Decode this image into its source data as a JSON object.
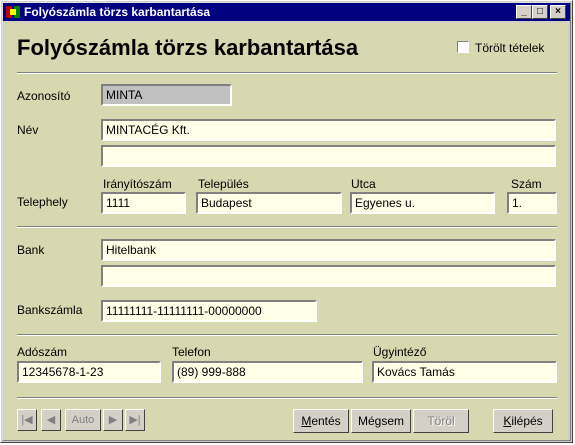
{
  "window": {
    "title": "Folyószámla törzs karbantartása",
    "minimize": "_",
    "maximize": "□",
    "close": "×"
  },
  "form": {
    "heading": "Folyószámla törzs karbantartása",
    "deleted_items_label": "Törölt tételek",
    "id_label": "Azonosító",
    "id_value": "MINTA",
    "name_label": "Név",
    "name_line1": "MINTACÉG Kft.",
    "name_line2": "",
    "site_label": "Telephely",
    "zip_label": "Irányítószám",
    "zip_value": "1111",
    "city_label": "Település",
    "city_value": "Budapest",
    "street_label": "Utca",
    "street_value": "Egyenes u.",
    "number_label": "Szám",
    "number_value": "1.",
    "bank_label": "Bank",
    "bank_line1": "Hitelbank",
    "bank_line2": "",
    "account_label": "Bankszámla",
    "account_value": "11111111-11111111-00000000",
    "tax_label": "Adószám",
    "tax_value": "12345678-1-23",
    "phone_label": "Telefon",
    "phone_value": "(89) 999-888",
    "agent_label": "Ügyintéző",
    "agent_value": "Kovács Tamás"
  },
  "nav": {
    "first": "|◀",
    "prev": "◀",
    "auto": "Auto",
    "next": "▶",
    "last": "▶|"
  },
  "buttons": {
    "save_u": "M",
    "save_rest": "entés",
    "cancel_pre": "Mé",
    "cancel_u": "g",
    "cancel_rest": "sem",
    "delete": "Töröl",
    "exit_u": "K",
    "exit_rest": "ilépés"
  }
}
